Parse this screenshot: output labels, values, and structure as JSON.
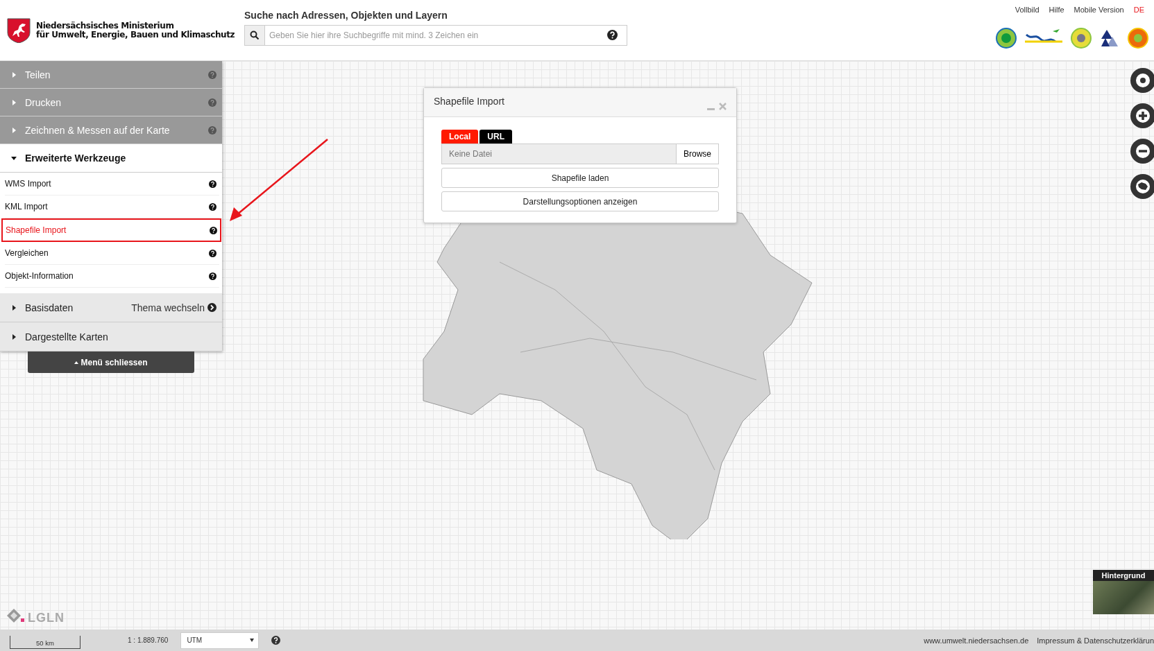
{
  "header": {
    "ministry": [
      "Niedersächsisches Ministerium",
      "für Umwelt, Energie, Bauen und Klimaschutz"
    ],
    "search": {
      "label": "Suche nach Adressen, Objekten und Layern",
      "placeholder": "Geben Sie hier ihre Suchbegriffe mit mind. 3 Zeichen ein"
    },
    "top_links": [
      {
        "label": "Vollbild",
        "selected": false
      },
      {
        "label": "Hilfe",
        "selected": false
      },
      {
        "label": "Mobile Version",
        "selected": false
      },
      {
        "label": "DE",
        "selected": true
      }
    ]
  },
  "sidebar": {
    "items": [
      {
        "kind": "section",
        "label": "Teilen",
        "expanded": false
      },
      {
        "kind": "section",
        "label": "Drucken",
        "expanded": false
      },
      {
        "kind": "section",
        "label": "Zeichnen & Messen auf der Karte",
        "expanded": false
      },
      {
        "kind": "section",
        "label": "Erweiterte Werkzeuge",
        "expanded": true,
        "children": [
          {
            "label": "WMS Import",
            "highlighted": false
          },
          {
            "label": "KML Import",
            "highlighted": false
          },
          {
            "label": "Shapefile Import",
            "highlighted": true
          },
          {
            "label": "Vergleichen",
            "highlighted": false
          },
          {
            "label": "Objekt-Information",
            "highlighted": false
          }
        ]
      },
      {
        "kind": "theme",
        "label": "Basisdaten",
        "expanded": false,
        "action": "Thema wechseln"
      },
      {
        "kind": "theme",
        "label": "Dargestellte Karten",
        "expanded": false
      }
    ],
    "close_button": "Menü schliessen"
  },
  "dialog": {
    "title": "Shapefile Import",
    "tabs": [
      {
        "label": "Local",
        "selected": true
      },
      {
        "label": "URL",
        "selected": false
      }
    ],
    "file_field": {
      "placeholder": "Keine Datei"
    },
    "browse_button": "Browse",
    "buttons": [
      "Shapefile laden",
      "Darstellungsoptionen anzeigen"
    ]
  },
  "background_switcher": {
    "label": "Hintergrund"
  },
  "logo_text": "LGLN",
  "status_bar": {
    "scale": "50 km",
    "ratio": "1 : 1.889.760",
    "projection": "UTM",
    "links": [
      "www.umwelt.niedersachsen.de",
      "Impressum & Datenschutzerklärun"
    ]
  }
}
